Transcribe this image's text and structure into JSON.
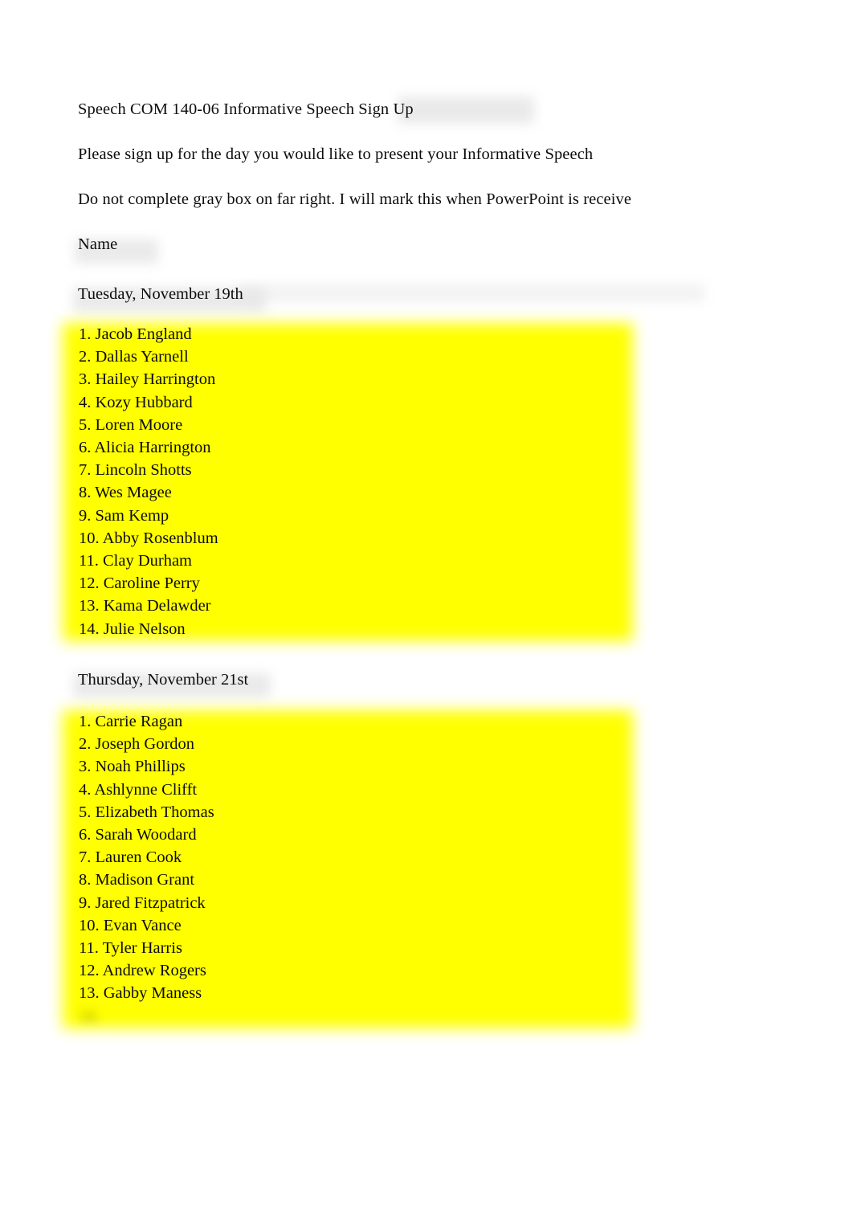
{
  "document": {
    "title": "Speech COM 140-06 Informative Speech Sign Up",
    "instruction_1": "Please sign up for the day you would like to present your Informative Speech",
    "instruction_2": "Do not complete gray box on far right. I will mark this when PowerPoint is receive",
    "column_label": "Name"
  },
  "colors": {
    "highlight": "#ffff00",
    "text": "#0d0d0d",
    "page": "#ffffff",
    "smudge": "#e6e6e6"
  },
  "sections": [
    {
      "heading": "Tuesday, November 19th",
      "entries": [
        "1. Jacob England",
        "2. Dallas Yarnell",
        "3. Hailey Harrington",
        "4. Kozy Hubbard",
        "5. Loren Moore",
        "6. Alicia Harrington",
        "7. Lincoln Shotts",
        "8. Wes Magee",
        "9. Sam Kemp",
        "10. Abby Rosenblum",
        "11. Clay Durham",
        "12. Caroline Perry",
        "13. Kama Delawder",
        "14. Julie Nelson"
      ]
    },
    {
      "heading": "Thursday, November 21st",
      "entries": [
        "1. Carrie Ragan",
        "2. Joseph Gordon",
        "3. Noah Phillips",
        "4. Ashlynne Clifft",
        "5. Elizabeth Thomas",
        "6. Sarah Woodard",
        "7. Lauren Cook",
        "8. Madison Grant",
        "9. Jared Fitzpatrick",
        "10. Evan Vance",
        "11. Tyler Harris",
        "12. Andrew Rogers",
        "13. Gabby Maness",
        "14. "
      ]
    }
  ]
}
